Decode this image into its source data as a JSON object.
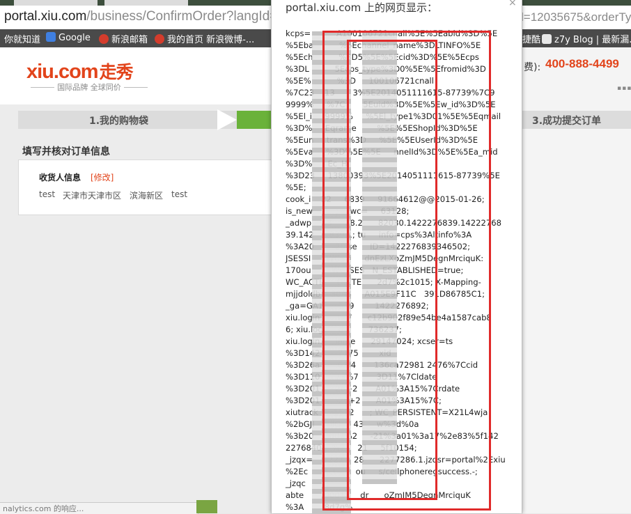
{
  "browser": {
    "address_prefix": "portal.xiu.com",
    "address_path": "/business/ConfirmOrder?langId=-7&",
    "address_suffix": "l=12035675&orderTy",
    "bookmarks": [
      {
        "label": "你就知道",
        "icon": "bookmark-icon"
      },
      {
        "label": "Google",
        "icon": "google-icon"
      },
      {
        "label": "新浪邮箱",
        "icon": "sina-weibo-icon"
      },
      {
        "label": "我的首页 新浪微博-...",
        "icon": "sina-weibo-icon"
      },
      {
        "label": "捷酷",
        "icon": "bookmark-icon"
      },
      {
        "label": "z7y Blog | 最新漏...",
        "icon": "blog-icon"
      }
    ],
    "status_text": "nalytics.com 的响应..."
  },
  "site": {
    "logo_text": "xiu.com",
    "logo_zh": "走秀",
    "slogan": "国际品牌  全球同价",
    "hotline_label": "费):",
    "hotline": "400-888-4499",
    "steps": [
      "1.我的购物袋",
      "3.成功提交订单"
    ],
    "order_title": "填写并核对订单信息",
    "receiver_label": "收货人信息",
    "receiver_edit": "[修改]",
    "receiver_values": [
      "test",
      "天津市天津市区",
      "滨海新区",
      "test"
    ]
  },
  "dialog": {
    "title": "portal.xiu.com 上的网页显示：",
    "close": "×",
    "cookie_lines": [
      "kcps=          A100106721cnall%5E%5Eabid%3D%5E",
      "%5Eba          %5Echannel_name%3DLTINFO%5E",
      "%5Ech          %3D5%5E%5Ecid%3D%5E%5Ecps",
      "%3DL          5Ecps_type%3D0%5E%5Efromid%3D",
      "%5E%          %3D     100106721cnall",
      "%7C23    13       3%5E2014051111615-87739%7C9",
      "9999%     %7C       5Euid%3D%5E%5Ew_id%3D%5E",
      "%5El_i     9999%     %5El_type1%3D01%5E%5Eqmail",
      "%3D%     Eqrame        %5E%5EShopId%3D%5E",
      "%5Eun     trans%3D     %5E%5EUserId%3D%5E",
      "%5Eva     %3D%5E%5E     nnelId%3D%5E%5Ea_mid",
      "%3D%      Ec_H",
      "%3D23     13800393%5E2014051111615-87739%5E",
      "%5E;",
      "cook_i    22     6839     91664612@@2015-01-26;",
      "is_new         ; _awc=     63128;",
      "_adwp    63     28.2      82030.1422276839.14222768",
      "39.142      839.1; tu     info=cps%3Altinfo%3A",
      "%3A20       -26 se     ID=1422276839346502;",
      "JSESSI      WCS=     dnEzLXoZmJM5DegnMrciquK:",
      "170ou        WC_SES   N_ESTABLISHED=true;",
      "WC_ACTI      DINTE      2d7%2c1015; X-Mapping-",
      "mjjdoldb    30A8     A015E9F11C   391D86785C1;",
      "_ga=GA1      579        1422276892;",
      "xiu.login.      I=7      c12b902f89e54be4a1587cab8",
      "6; xiu.log      d=       736237;",
      "xiu.login.     lame      29147024; xcser=ts",
      "%3D142       7175        xid",
      "%3D26a      .63f4       136ca72981 2476%7Ccid",
      "%3D110      73%7       3D11%7Cldate",
      "%3D201      26+2       A01%3A15%7Crdate",
      "%3D201      -26+2      A01%3A15%7C;",
      "xiutrack      1502      ; WC_PERSISTENT=X21L4wja",
      "%2bGJI      llG     43     w%3d%0a",
      "%3b20      d01%2     -21%3a01%3a17%2e83%5f142",
      "2276840    %2     21     5f10154;",
      "_jzqx=      227    28      2277286.1.jzqsr=portal%2Exiu",
      "%2Ec      qct=     ou     s/cellphoneregsuccess.-;",
      "_jzqc      1;",
      "abte        0001      dr      oZmJM5DegnMrciquK",
      "%3A        8d7g%"
    ]
  },
  "colors": {
    "brand": "#e2441b",
    "step_active": "#6ab23a",
    "highlight_box": "#e02a2a"
  }
}
